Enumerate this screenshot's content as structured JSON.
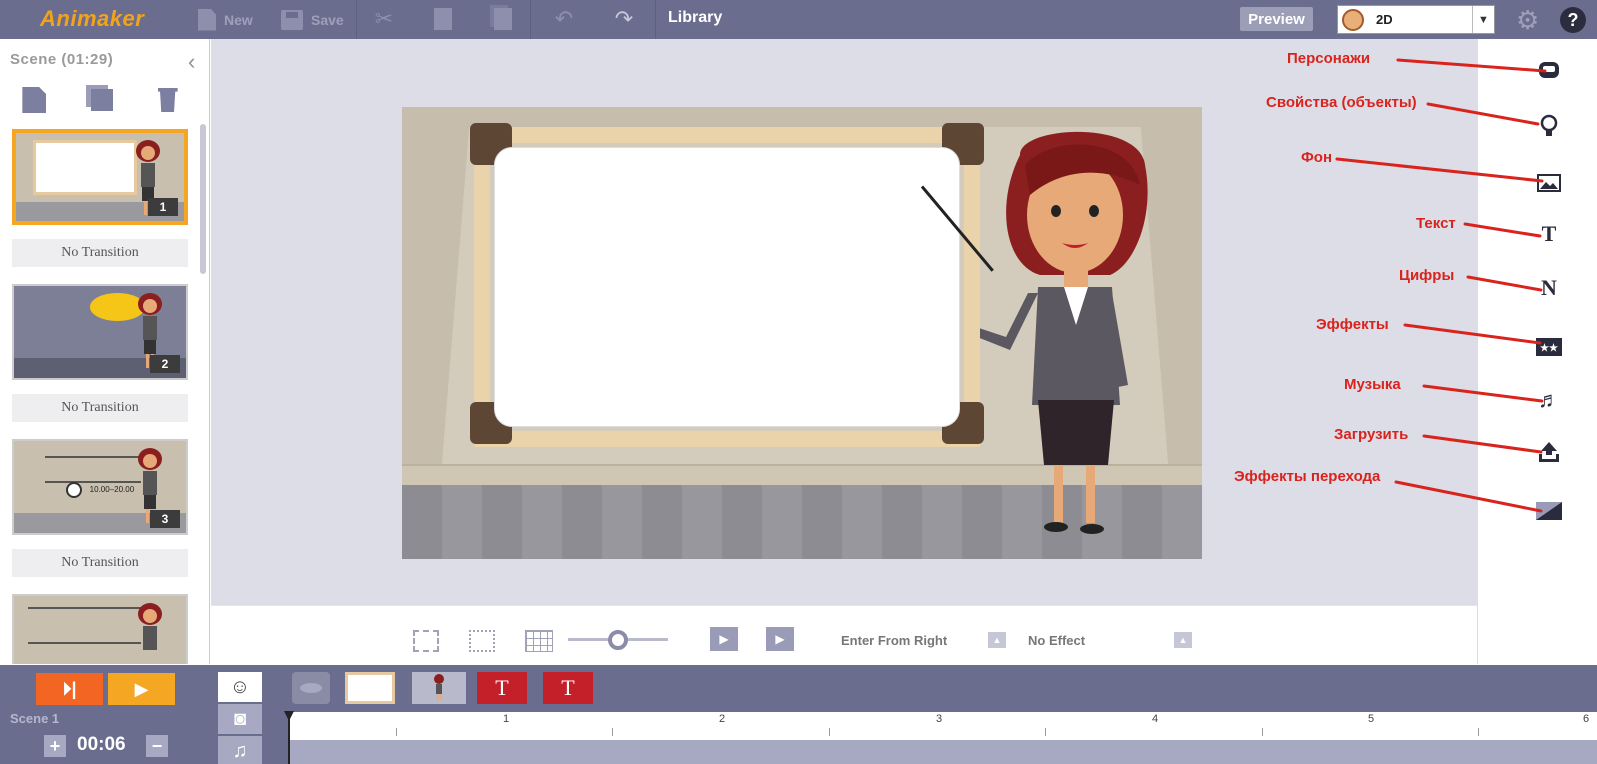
{
  "topbar": {
    "logo": "Animaker",
    "new_label": "New",
    "save_label": "Save",
    "library_label": "Library",
    "preview_label": "Preview",
    "mode_value": "2D"
  },
  "scene_panel": {
    "header": "Scene  (01:29)",
    "transitions": [
      "No Transition",
      "No Transition",
      "No Transition"
    ],
    "scene_numbers": [
      "1",
      "2",
      "3"
    ],
    "scene3_time": "10.00–20.00"
  },
  "annotations": [
    "Персонажи",
    "Свойства (объекты)",
    "Фон",
    "Текст",
    "Цифры",
    "Эффекты",
    "Музыка",
    "Загрузить",
    "Эффекты перехода"
  ],
  "right_icons": [
    "character-icon",
    "bulb-icon",
    "image-icon",
    "text-T-icon",
    "number-N-icon",
    "effects-star-icon",
    "music-note-icon",
    "upload-icon",
    "transition-icon"
  ],
  "props_bar": {
    "enter_effect": "Enter From Right",
    "exit_effect": "No Effect"
  },
  "timeline": {
    "scene_label": "Scene 1",
    "time": "00:06",
    "ruler_labels": [
      "1",
      "2",
      "3",
      "4",
      "5",
      "6"
    ],
    "chips": [
      "T",
      "T"
    ]
  },
  "colors": {
    "topbar": "#6b6d8f",
    "accent_orange": "#f5a623",
    "annotation_red": "#d9231d"
  }
}
